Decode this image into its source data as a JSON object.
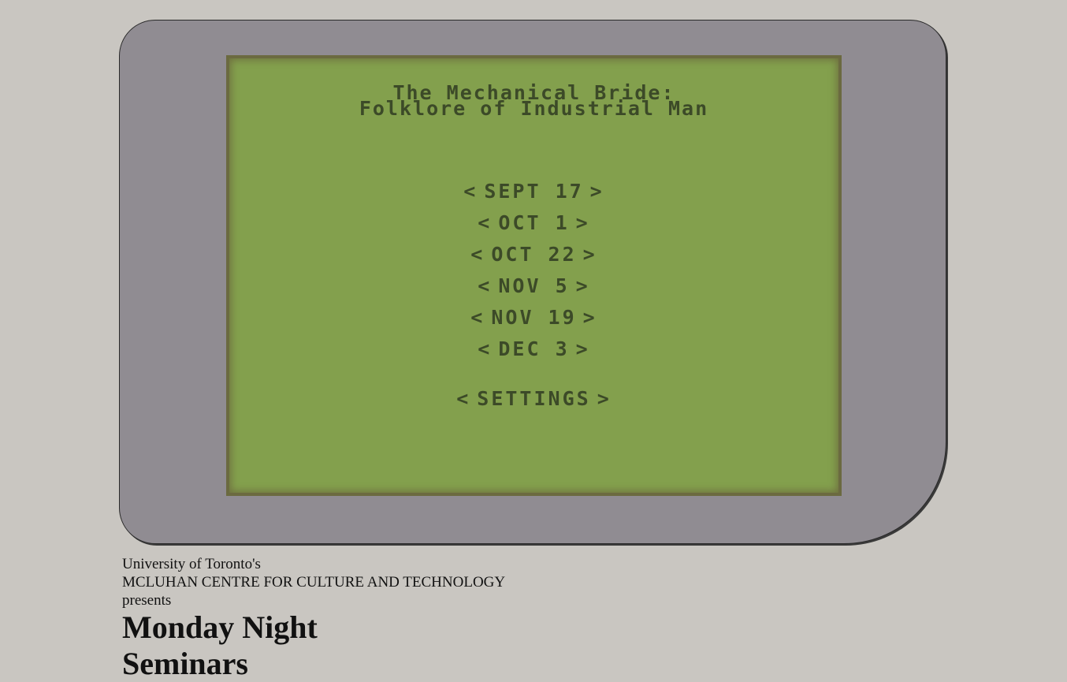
{
  "screen": {
    "title_line_1": "The Mechanical Bride:",
    "title_line_2": "Folklore of Industrial Man",
    "menu": [
      {
        "label": "SEPT 17"
      },
      {
        "label": "OCT 1"
      },
      {
        "label": "OCT 22"
      },
      {
        "label": "NOV 5"
      },
      {
        "label": "NOV 19"
      },
      {
        "label": "DEC 3"
      }
    ],
    "settings_label": "SETTINGS",
    "arrow_left": "<",
    "arrow_right": ">"
  },
  "credits": {
    "line_1": "University of Toronto's",
    "line_2": "MCLUHAN CENTRE FOR CULTURE AND TECHNOLOGY",
    "line_3": "presents",
    "heading_1": "Monday Night",
    "heading_2": "Seminars"
  },
  "colors": {
    "page_background": "#c9c6c1",
    "device_body": "#908c92",
    "screen_background": "#83a04d",
    "screen_text": "#3c4a28"
  }
}
